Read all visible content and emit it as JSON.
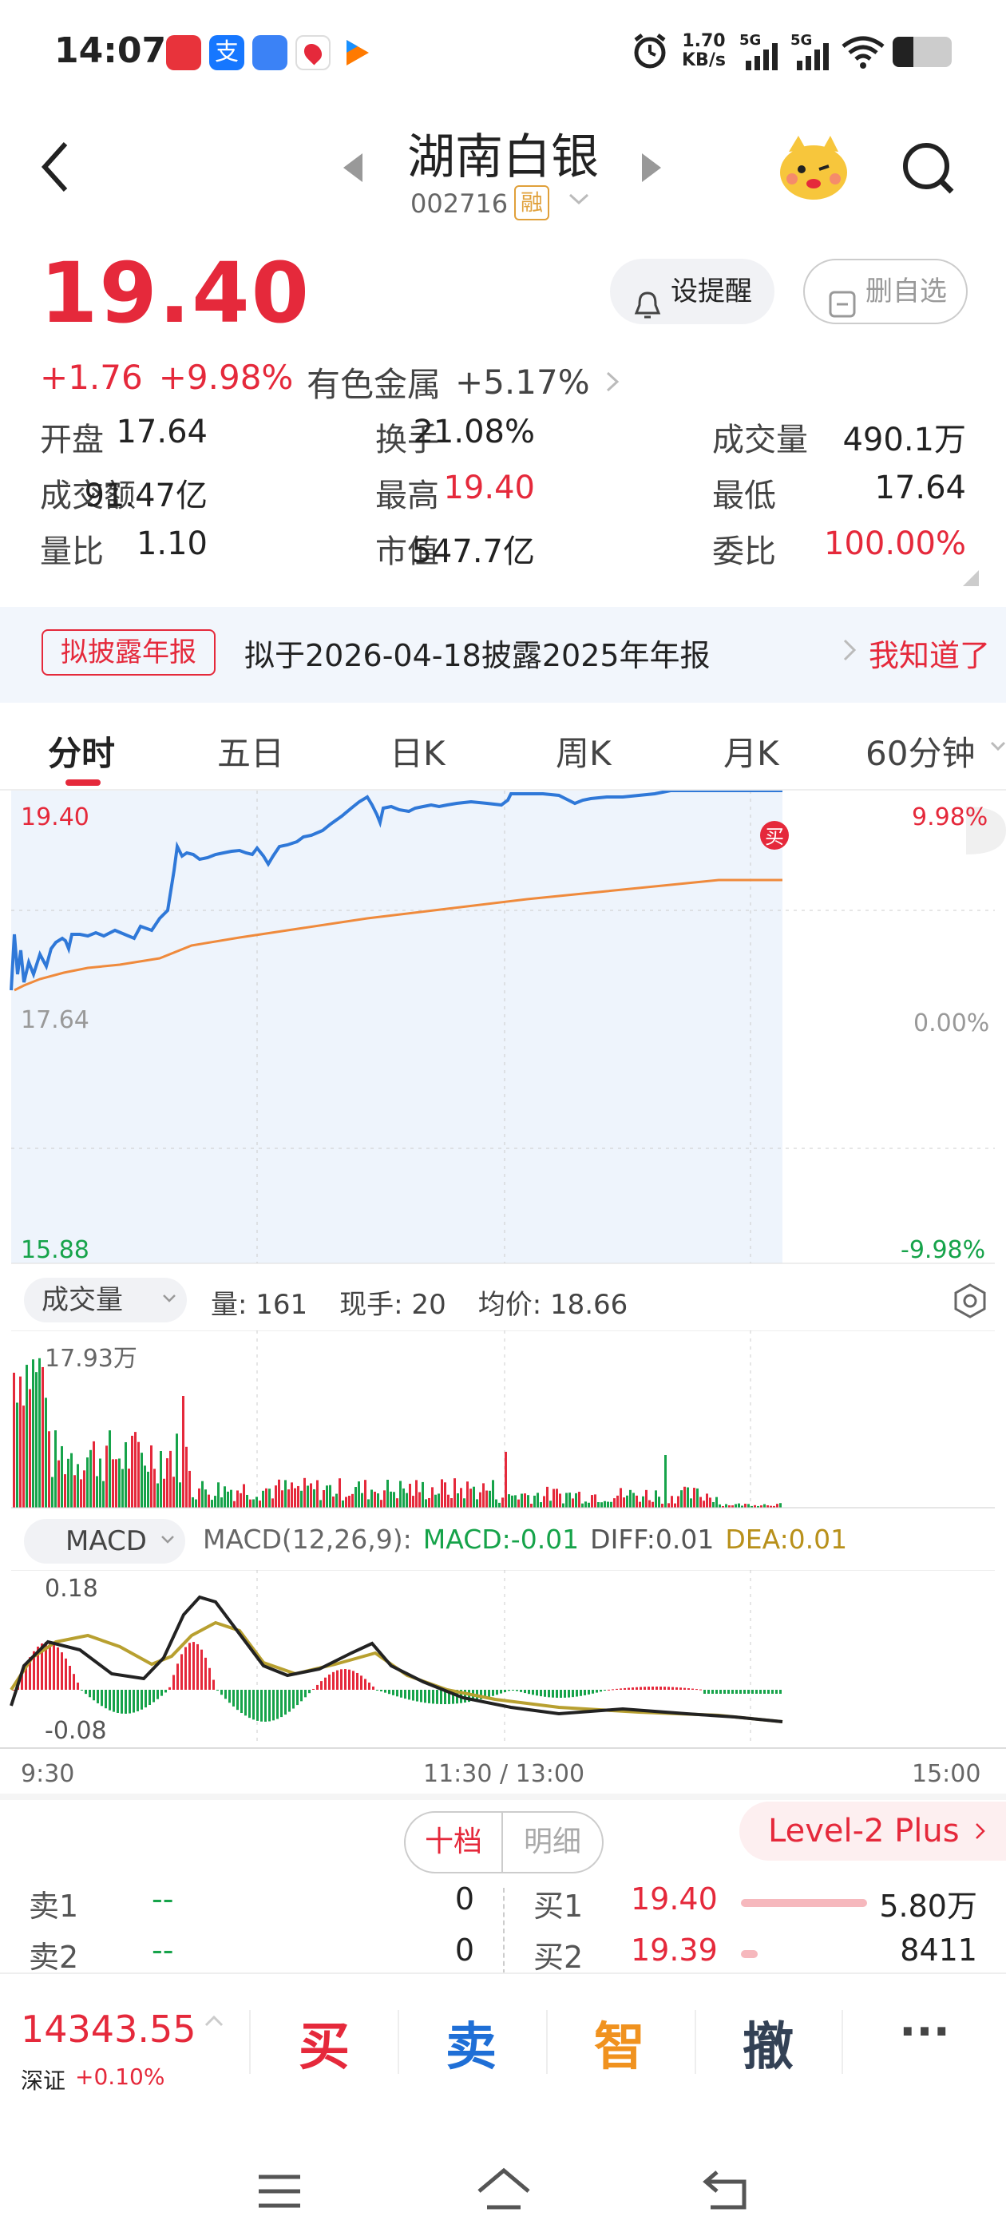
{
  "status_bar": {
    "time": "14:07",
    "net_speed_value": "1.70",
    "net_speed_unit": "KB/s",
    "sig1": "5G",
    "sig2": "5G"
  },
  "header": {
    "stock_name": "湖南白银",
    "stock_code": "002716",
    "badge": "融"
  },
  "quote": {
    "price": "19.40",
    "change": "+1.76",
    "change_pct": "+9.98%",
    "sector_name": "有色金属",
    "sector_pct": "+5.17%",
    "remind_btn": "设提醒",
    "delete_btn": "删自选"
  },
  "stats": [
    [
      {
        "label": "开盘",
        "value": "17.64",
        "color": "#222"
      },
      {
        "label": "换手",
        "value": "21.08%",
        "color": "#222"
      },
      {
        "label": "成交量",
        "value": "490.1万",
        "color": "#222"
      }
    ],
    [
      {
        "label": "成交额",
        "value": "91.47亿",
        "color": "#222"
      },
      {
        "label": "最高",
        "value": "19.40",
        "color": "#e5293b"
      },
      {
        "label": "最低",
        "value": "17.64",
        "color": "#222"
      }
    ],
    [
      {
        "label": "量比",
        "value": "1.10",
        "color": "#222"
      },
      {
        "label": "市值",
        "value": "547.7亿",
        "color": "#222"
      },
      {
        "label": "委比",
        "value": "100.00%",
        "color": "#e5293b"
      }
    ]
  ],
  "notice": {
    "tag": "拟披露年报",
    "text": "拟于2026-04-18披露2025年年报",
    "action": "我知道了"
  },
  "tabs": [
    "分时",
    "五日",
    "日K",
    "周K",
    "月K",
    "60分钟"
  ],
  "chart": {
    "price_high": "19.40",
    "price_mid": "17.64",
    "price_low": "15.88",
    "pct_high": "9.98%",
    "pct_mid": "0.00%",
    "pct_low": "-9.98%",
    "buy_marker": "买"
  },
  "volume_bar": {
    "label": "成交量",
    "vol": "量: 161",
    "hand": "现手: 20",
    "avg": "均价: 18.66",
    "max": "17.93万"
  },
  "macd": {
    "label": "MACD",
    "params": "MACD(12,26,9):",
    "macd_val": "MACD:-0.01",
    "diff_val": "DIFF:0.01",
    "dea_val": "DEA:0.01",
    "top": "0.18",
    "bottom": "-0.08"
  },
  "time_axis": {
    "start": "9:30",
    "mid": "11:30 / 13:00",
    "end": "15:00"
  },
  "order_book": {
    "tab_ten": "十档",
    "tab_detail": "明细",
    "level2": "Level-2 Plus",
    "sell": [
      {
        "label": "卖1",
        "price": "--",
        "vol": "0"
      },
      {
        "label": "卖2",
        "price": "--",
        "vol": "0"
      }
    ],
    "buy": [
      {
        "label": "买1",
        "price": "19.40",
        "vol": "5.80万",
        "bar": 0.45
      },
      {
        "label": "买2",
        "price": "19.39",
        "vol": "8411",
        "bar": 0.06
      }
    ]
  },
  "index": {
    "value": "14343.55",
    "name": "深证",
    "pct": "+0.10%"
  },
  "actions": {
    "buy": "买",
    "sell": "卖",
    "smart": "智",
    "cancel": "撤",
    "more": "···"
  }
}
